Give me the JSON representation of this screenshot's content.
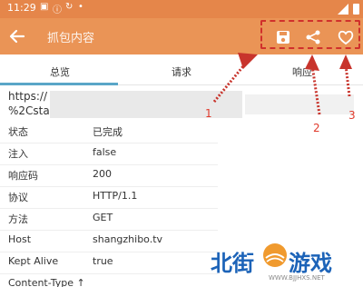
{
  "status_bar": {
    "time": "11:29"
  },
  "app_bar": {
    "title": "抓包内容"
  },
  "actions": {
    "save_icon": "save-icon",
    "share_icon": "share-icon",
    "favorite_icon": "heart-icon"
  },
  "tabs": [
    {
      "label": "总览",
      "selected": true
    },
    {
      "label": "请求",
      "selected": false
    },
    {
      "label": "响应",
      "selected": false
    }
  ],
  "url": {
    "line1": "https://",
    "line2": "%2Csta"
  },
  "rows": [
    {
      "key": "状态",
      "value": "已完成"
    },
    {
      "key": "注入",
      "value": "false"
    },
    {
      "key": "响应码",
      "value": "200"
    },
    {
      "key": "协议",
      "value": "HTTP/1.1"
    },
    {
      "key": "方法",
      "value": "GET"
    },
    {
      "key": "Host",
      "value": "shangzhibo.tv"
    },
    {
      "key": "Kept Alive",
      "value": "true"
    },
    {
      "key": "Content-Type ↑",
      "value": ""
    }
  ],
  "annotations": {
    "n1": "1",
    "n2": "2",
    "n3": "3"
  },
  "watermark": {
    "left": "北街",
    "right": "游戏",
    "url": "WWW.BJJHXS.NET"
  },
  "colors": {
    "status_bar": "#e5864a",
    "app_bar": "#ea9456",
    "tab_indicator": "#5aa6c8",
    "annotation": "#d0302c"
  }
}
